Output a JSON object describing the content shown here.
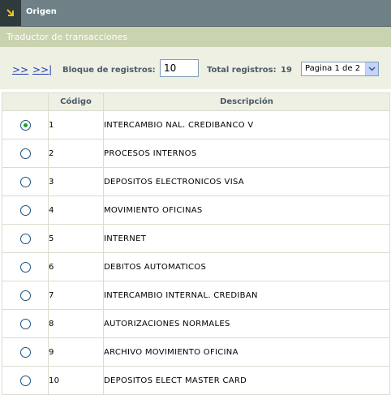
{
  "header": {
    "title": "Origen"
  },
  "section": {
    "title": "Traductor de transacciones"
  },
  "toolbar": {
    "next_label": ">>",
    "last_label": ">>|",
    "block_label": "Bloque de registros:",
    "block_value": "10",
    "total_label": "Total registros:",
    "total_value": "19",
    "page_selected": "Pagina 1 de 2"
  },
  "table": {
    "columns": [
      "",
      "Código",
      "Descripción"
    ],
    "selected_index": 0,
    "rows": [
      {
        "code": "1",
        "desc": "INTERCAMBIO NAL. CREDIBANCO V"
      },
      {
        "code": "2",
        "desc": "PROCESOS INTERNOS"
      },
      {
        "code": "3",
        "desc": "DEPOSITOS ELECTRONICOS VISA"
      },
      {
        "code": "4",
        "desc": "MOVIMIENTO OFICINAS"
      },
      {
        "code": "5",
        "desc": "INTERNET"
      },
      {
        "code": "6",
        "desc": "DEBITOS AUTOMATICOS"
      },
      {
        "code": "7",
        "desc": "INTERCAMBIO INTERNAL. CREDIBAN"
      },
      {
        "code": "8",
        "desc": "AUTORIZACIONES NORMALES"
      },
      {
        "code": "9",
        "desc": "ARCHIVO MOVIMIENTO OFICINA"
      },
      {
        "code": "10",
        "desc": "DEPOSITOS ELECT MASTER CARD"
      }
    ]
  }
}
